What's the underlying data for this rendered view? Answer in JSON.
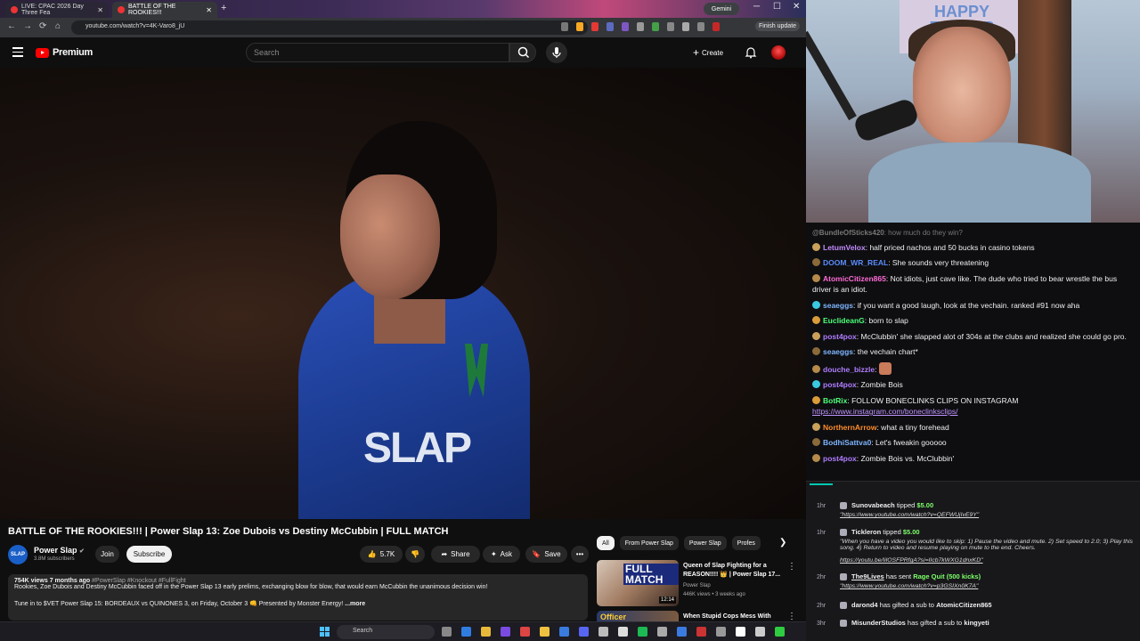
{
  "browser": {
    "tabs": [
      {
        "label": "LIVE: CPAC 2026 Day Three Fea"
      },
      {
        "label": "BATTLE OF THE ROOKIES!!!"
      }
    ],
    "new_tab": "+",
    "gemini": "Gemini",
    "url": "youtube.com/watch?v=4K-Varo8_jU",
    "finish_update": "Finish update",
    "controls": {
      "minimize": "─",
      "maximize": "☐",
      "close": "✕"
    },
    "nav": {
      "back": "←",
      "forward": "→",
      "reload": "⟳",
      "home": "⌂"
    }
  },
  "youtube": {
    "brand": "Premium",
    "search_placeholder": "Search",
    "create_label": "Create",
    "create_plus": "+"
  },
  "video": {
    "jersey_text": "SLAP",
    "title": "BATTLE OF THE ROOKIES!!! | Power Slap 13: Zoe Dubois vs Destiny McCubbin | FULL MATCH",
    "channel": {
      "avatar_text": "SLAP",
      "name": "Power Slap",
      "subscribers": "3.8M subscribers",
      "join": "Join",
      "subscribe": "Subscribe"
    },
    "actions": {
      "likes": "5.7K",
      "share": "Share",
      "ask": "Ask",
      "save": "Save",
      "more": "•••"
    },
    "description": {
      "views_date": "754K views  7 months ago",
      "tags": "#PowerSlap #Knockout #FullFight",
      "line1": "Rookies, Zoe Dubois and Destiny McCubbin faced off in the Power Slap 13 early prelims, exchanging blow for blow, that would earn McCubbin the unanimous decision win!",
      "line2": "Tune in to $VET Power Slap 15: BORDEAUX vs QUINONES 3, on Friday, October 3 👊 Presented by Monster Energy!",
      "more_label": "...more"
    }
  },
  "recommendations": {
    "chips": [
      "All",
      "From Power Slap",
      "Power Slap",
      "Profes"
    ],
    "items": [
      {
        "thumb_text": "FULL MATCH",
        "duration": "12:14",
        "title": "Queen of Slap Fighting for a REASON!!!! 👑 | Power Slap 17...",
        "channel": "Power Slap",
        "meta": "446K views • 3 weeks ago"
      },
      {
        "thumb_text": "Officer",
        "title": "When Stupid Cops Mess With"
      }
    ]
  },
  "webcam": {
    "poster_text": "HAPPY EASTER"
  },
  "chat": {
    "messages": [
      {
        "user": "@BundleOfSticks420",
        "text": ": how much do they win?",
        "color": "#777777",
        "faded": true
      },
      {
        "user": "LetumVelox",
        "text": ": half priced nachos and 50 bucks in casino tokens",
        "color": "#c38bff"
      },
      {
        "user": "DOOM_WR_REAL",
        "text": ": She sounds very threatening",
        "color": "#5a8dff"
      },
      {
        "user": "AtomicCitizen865",
        "text": ": Not idiots, just cave like. The dude who tried to bear wrestle the bus driver is an idiot.",
        "color": "#ff6bd6"
      },
      {
        "user": "seaeggs",
        "text": ": if you want a good laugh, look at the vechain. ranked #91 now aha",
        "color": "#7fb5ff"
      },
      {
        "user": "EuclideanG",
        "text": ": born to slap",
        "color": "#4dff7a"
      },
      {
        "user": "post4pox",
        "text": ": McClubbin' she slapped alot of 304s at the clubs and realized she could go pro.",
        "color": "#b07dff"
      },
      {
        "user": "seaeggs",
        "text": ": the vechain chart*",
        "color": "#7fb5ff"
      },
      {
        "user": "douche_bizzle",
        "text": ": ",
        "color": "#b07dff",
        "emote": true
      },
      {
        "user": "post4pox",
        "text": ": Zombie Bois",
        "color": "#b07dff"
      },
      {
        "user": "BotRix",
        "text": ": FOLLOW BONECLINKS CLIPS ON INSTAGRAM",
        "color": "#4dff7a",
        "link": "https://www.instagram.com/boneclinksclips/"
      },
      {
        "user": "NorthernArrow",
        "text": ": what a tiny forehead",
        "color": "#ff8c2a"
      },
      {
        "user": "BodhiSattva0",
        "text": ": Let's fweakin gooooo",
        "color": "#7fb5ff"
      },
      {
        "user": "post4pox",
        "text": ": Zombie Bois vs. McClubbin'",
        "color": "#b07dff"
      }
    ]
  },
  "events": [
    {
      "time": "1hr",
      "user": "Sunovabeach",
      "action": " tipped ",
      "amount": "$5.00",
      "sub": "\"https://www.youtube.com/watch?v=QEFWUjIvE9Y\""
    },
    {
      "time": "1hr",
      "user": "Tickleron",
      "action": " tipped ",
      "amount": "$5.00",
      "sub": "\"When you have a video you would like to skip: 1) Pause the video and mute. 2) Set speed to 2.0; 3) Play this song. 4) Return to video and resume playing on mute to the end. Cheers.",
      "sub2": "https://youtu.be/IilOSFPRfgA?si=IIcb7kWXG1dnxKD\""
    },
    {
      "time": "2hr",
      "user": "The9Lives",
      "action": " has sent ",
      "amount": "Rage Quit (500 kicks)",
      "sub": "\"https://www.youtube.com/watch?v=p3GSIXn0K7A\""
    },
    {
      "time": "2hr",
      "user": "darond4",
      "action": " has gifted a sub to ",
      "amount": "AtomicCitizen865"
    },
    {
      "time": "3hr",
      "user": "MisunderStudios",
      "action": " has gifted a sub to ",
      "amount": "kingyeti"
    }
  ],
  "taskbar": {
    "search_placeholder": "Search"
  }
}
